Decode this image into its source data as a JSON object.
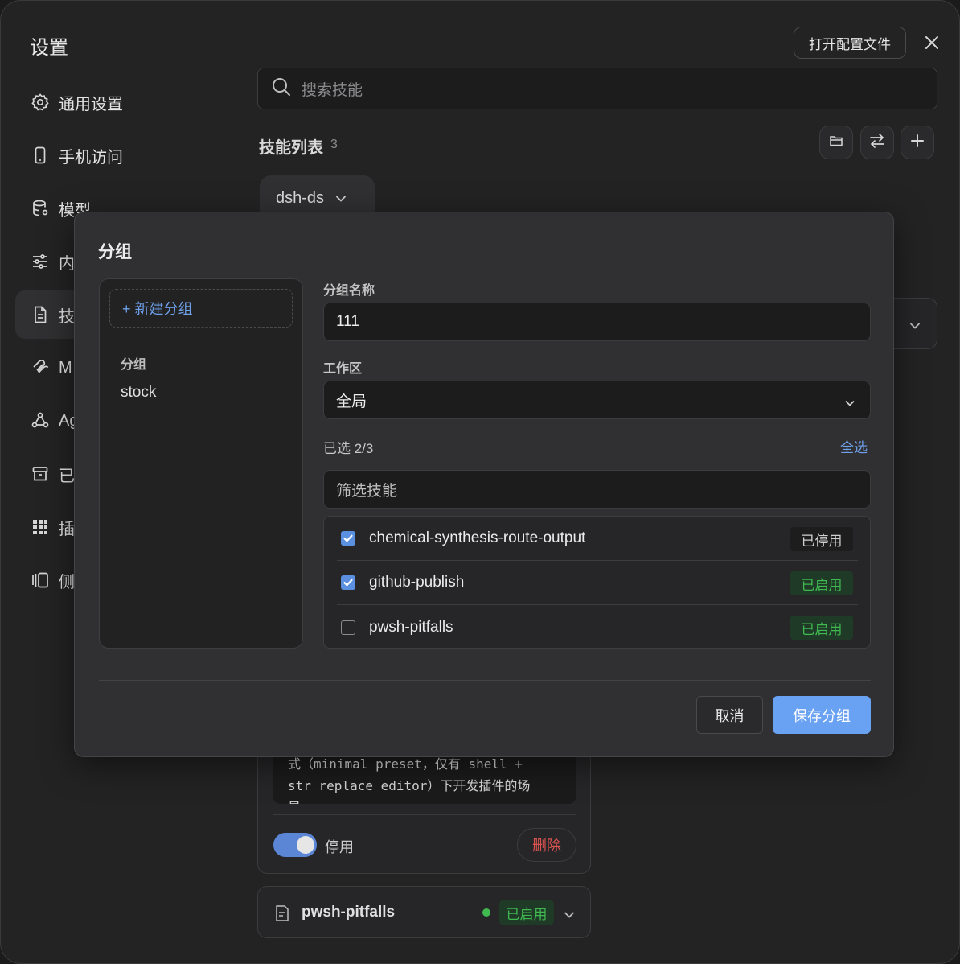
{
  "window": {
    "title": "设置",
    "open_config_label": "打开配置文件"
  },
  "sidebar": {
    "items": [
      {
        "label": "通用设置",
        "icon": "gear-icon"
      },
      {
        "label": "手机访问",
        "icon": "phone-icon"
      },
      {
        "label": "模型",
        "icon": "database-icon"
      },
      {
        "label": "内",
        "icon": "sliders-icon"
      },
      {
        "label": "技",
        "icon": "document-icon",
        "active": true
      },
      {
        "label": "M",
        "icon": "mcp-icon"
      },
      {
        "label": "Ag",
        "icon": "agent-icon"
      },
      {
        "label": "已",
        "icon": "archive-icon"
      },
      {
        "label": "插",
        "icon": "grid-icon"
      },
      {
        "label": "侧",
        "icon": "sidebar-icon"
      }
    ]
  },
  "main": {
    "search_placeholder": "搜索技能",
    "skills_title": "技能列表",
    "skills_count": "3",
    "workspace_value": "dsh-ds",
    "expanded_card": {
      "code_lines": [
        "式（minimal preset，仅有 shell +",
        "str_replace_editor）下开发插件的场",
        "景"
      ],
      "toggle_label": "停用",
      "delete_label": "删除"
    },
    "pwsh_card": {
      "name": "pwsh-pitfalls",
      "status": "已启用",
      "status_color": "#3fb950"
    }
  },
  "dialog": {
    "title": "分组",
    "new_group_label": "+ 新建分组",
    "groups_section": "分组",
    "groups": [
      "stock"
    ],
    "name_label": "分组名称",
    "name_value": "111",
    "workspace_label": "工作区",
    "workspace_value": "全局",
    "selected_text": "已选 2/3",
    "select_all_label": "全选",
    "filter_placeholder": "筛选技能",
    "skills": [
      {
        "name": "chemical-synthesis-route-output",
        "checked": true,
        "status": "已停用"
      },
      {
        "name": "github-publish",
        "checked": true,
        "status": "已启用"
      },
      {
        "name": "pwsh-pitfalls",
        "checked": false,
        "status": "已启用"
      }
    ],
    "cancel_label": "取消",
    "save_label": "保存分组",
    "accent_color": "#6aa2f3"
  }
}
